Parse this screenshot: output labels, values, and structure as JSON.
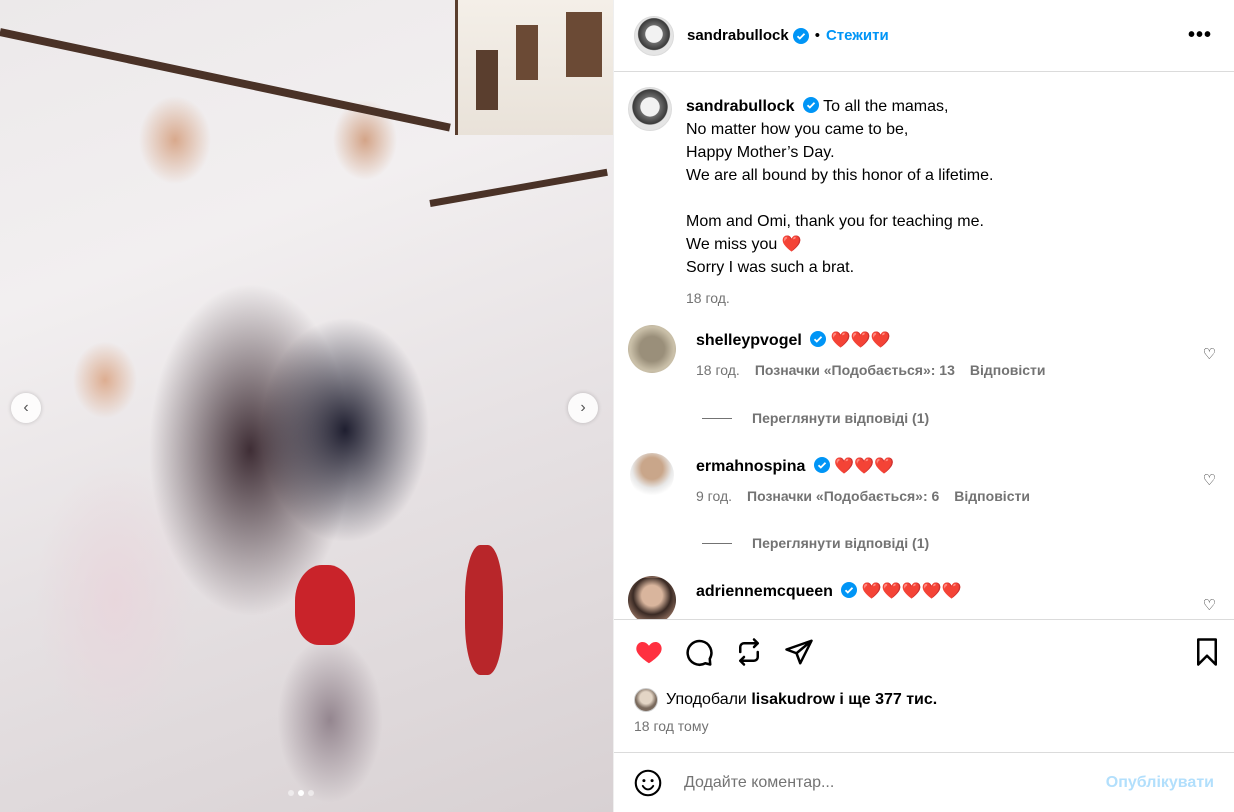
{
  "post": {
    "author": "sandrabullock",
    "follow_sep": "•",
    "follow_label": "Стежити",
    "more_label": "•••",
    "caption_lines": [
      "To all the mamas,",
      "No matter how you came to be,",
      "Happy Mother’s Day.",
      "We are all bound by this honor of a lifetime.",
      "",
      "Mom and Omi, thank you for teaching me.",
      "We miss you ❤️",
      "Sorry I was such a brat."
    ],
    "caption_time": "18 год."
  },
  "comments": [
    {
      "user": "shelleypvogel",
      "text": "❤️❤️❤️",
      "time": "18 год.",
      "likes": "Позначки «Подобається»: 13",
      "reply": "Відповісти",
      "view_replies": "Переглянути відповіді (1)"
    },
    {
      "user": "ermahnospina",
      "text": "❤️❤️❤️",
      "time": "9 год.",
      "likes": "Позначки «Подобається»: 6",
      "reply": "Відповісти",
      "view_replies": "Переглянути відповіді (1)"
    },
    {
      "user": "adriennemcqueen",
      "text": "❤️❤️❤️❤️❤️"
    }
  ],
  "likes": {
    "prefix": "Уподобали",
    "user": "lisakudrow",
    "suffix": "і ще 377 тис."
  },
  "posted": "18 год тому",
  "add_comment": {
    "placeholder": "Додайте коментар...",
    "publish": "Опублікувати"
  },
  "carousel": {
    "prev": "‹",
    "next": "›",
    "slides": 3,
    "active": 2
  },
  "colors": {
    "accent": "#0095f6",
    "liked": "#ff3040",
    "publish_disabled": "#b2dffc"
  }
}
